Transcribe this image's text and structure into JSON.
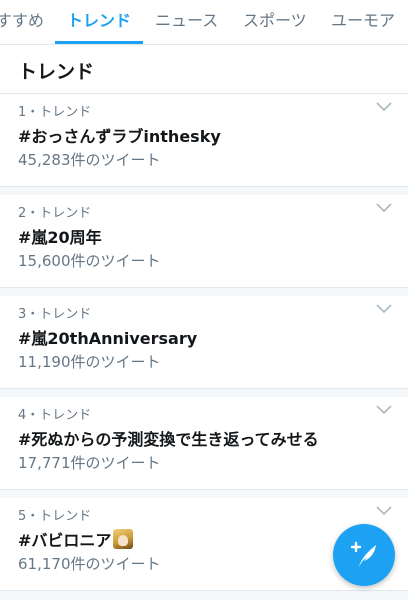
{
  "tabs": [
    {
      "label": "すすめ",
      "active": false
    },
    {
      "label": "トレンド",
      "active": true
    },
    {
      "label": "ニュース",
      "active": false
    },
    {
      "label": "スポーツ",
      "active": false
    },
    {
      "label": "ユーモア",
      "active": false
    }
  ],
  "section": {
    "title": "トレンド"
  },
  "trends": [
    {
      "rank": "1・トレンド",
      "name": "#おっさんずラブinthesky",
      "count": "45,283件のツイート"
    },
    {
      "rank": "2・トレンド",
      "name": "#嵐20周年",
      "count": "15,600件のツイート"
    },
    {
      "rank": "3・トレンド",
      "name": "#嵐20thAnniversary",
      "count": "11,190件のツイート"
    },
    {
      "rank": "4・トレンド",
      "name": "#死ぬからの予測変換で生き返ってみせる",
      "count": "17,771件のツイート"
    },
    {
      "rank": "5・トレンド",
      "name": "#バビロニア",
      "count": "61,170件のツイート",
      "emoji_icon": "anime-character-emoji"
    }
  ],
  "icons": {
    "row_menu": "chevron-down-icon",
    "compose": "compose-tweet-icon"
  },
  "colors": {
    "accent": "#1da1f2",
    "text_primary": "#14171a",
    "text_secondary": "#657786",
    "divider": "#e1e8ed",
    "background": "#f5f8fa"
  }
}
